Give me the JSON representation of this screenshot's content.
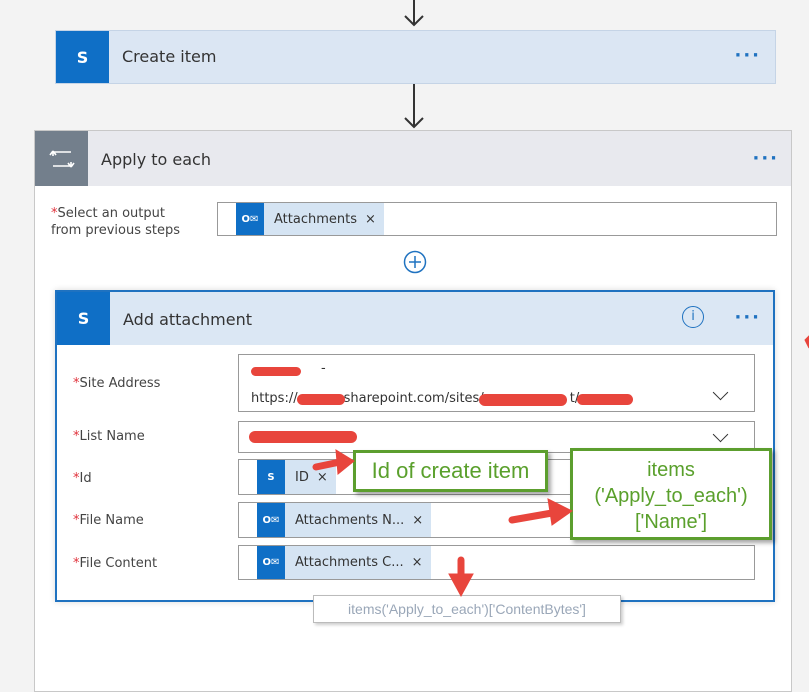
{
  "create_item": {
    "title": "Create item",
    "icon": "sharepoint-icon",
    "menu": "···"
  },
  "apply_to_each": {
    "title": "Apply to each",
    "icon": "loop-icon",
    "menu": "···",
    "select_label": "Select an output from previous steps",
    "required": "*",
    "select_token": "Attachments",
    "remove": "×"
  },
  "add_attachment": {
    "title": "Add attachment",
    "menu": "···",
    "info": "i",
    "fields": [
      {
        "label": "Site Address",
        "value_line1": "-",
        "value_line2": "https://",
        "value_mid": "sharepoint.com/sites/",
        "value_end": "t/"
      },
      {
        "label": "List Name"
      },
      {
        "label": "Id",
        "token": "ID"
      },
      {
        "label": "File Name",
        "token": "Attachments N..."
      },
      {
        "label": "File Content",
        "token": "Attachments C..."
      }
    ]
  },
  "annotations": {
    "id_callout": "Id of create item",
    "name_callout_l1": "items",
    "name_callout_l2": "('Apply_to_each')",
    "name_callout_l3": "['Name']",
    "tooltip": "items('Apply_to_each')['ContentBytes']"
  },
  "colors": {
    "accent": "#1f72c0",
    "sharepoint": "#0f6fc6",
    "callout_green": "#5aa02c",
    "arrow_red": "#e8453c"
  }
}
